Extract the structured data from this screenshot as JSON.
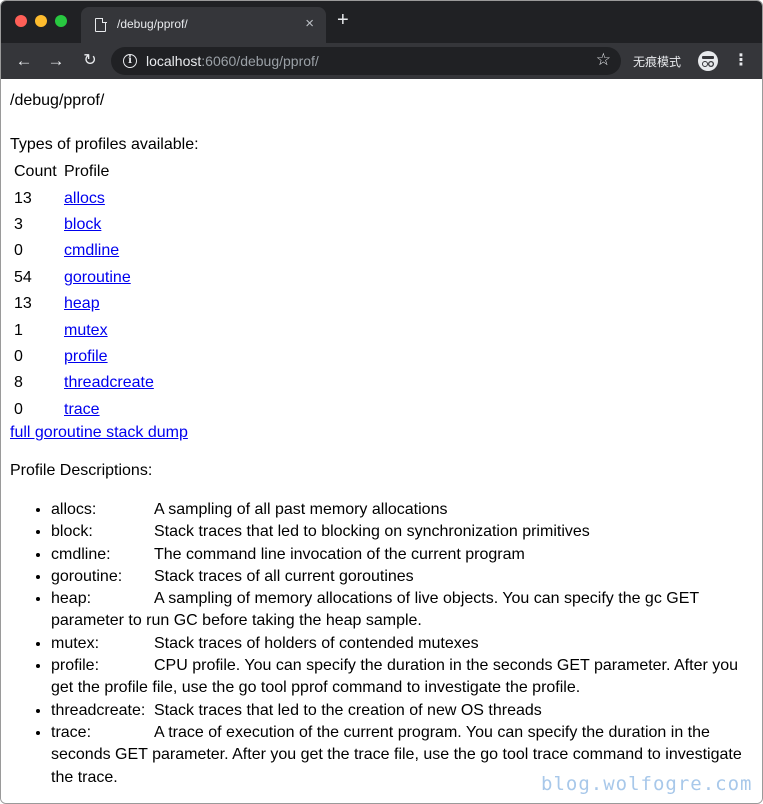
{
  "browser": {
    "tab_title": "/debug/pprof/",
    "tab_close": "×",
    "new_tab": "+",
    "url_host": "localhost",
    "url_rest": ":6060/debug/pprof/",
    "incognito_label": "无痕模式",
    "icons": [
      "back-icon",
      "forward-icon",
      "reload-icon",
      "info-icon",
      "star-icon",
      "incognito-icon",
      "menu-icon"
    ]
  },
  "page": {
    "path_heading": "/debug/pprof/",
    "types_heading": "Types of profiles available:",
    "table_headers": [
      "Count",
      "Profile"
    ],
    "profiles": [
      {
        "count": "13",
        "name": "allocs"
      },
      {
        "count": "3",
        "name": "block"
      },
      {
        "count": "0",
        "name": "cmdline"
      },
      {
        "count": "54",
        "name": "goroutine"
      },
      {
        "count": "13",
        "name": "heap"
      },
      {
        "count": "1",
        "name": "mutex"
      },
      {
        "count": "0",
        "name": "profile"
      },
      {
        "count": "8",
        "name": "threadcreate"
      },
      {
        "count": "0",
        "name": "trace"
      }
    ],
    "full_dump_link": "full goroutine stack dump",
    "descriptions_heading": "Profile Descriptions:",
    "descriptions": [
      {
        "name": "allocs:",
        "text": "A sampling of all past memory allocations"
      },
      {
        "name": "block:",
        "text": "Stack traces that led to blocking on synchronization primitives"
      },
      {
        "name": "cmdline:",
        "text": "The command line invocation of the current program"
      },
      {
        "name": "goroutine:",
        "text": "Stack traces of all current goroutines"
      },
      {
        "name": "heap:",
        "text": "A sampling of memory allocations of live objects. You can specify the gc GET parameter to run GC before taking the heap sample."
      },
      {
        "name": "mutex:",
        "text": "Stack traces of holders of contended mutexes"
      },
      {
        "name": "profile:",
        "text": "CPU profile. You can specify the duration in the seconds GET parameter. After you get the profile file, use the go tool pprof command to investigate the profile."
      },
      {
        "name": "threadcreate:",
        "text": "Stack traces that led to the creation of new OS threads"
      },
      {
        "name": "trace:",
        "text": "A trace of execution of the current program. You can specify the duration in the seconds GET parameter. After you get the trace file, use the go tool trace command to investigate the trace."
      }
    ]
  },
  "watermark": "blog.wolfogre.com"
}
